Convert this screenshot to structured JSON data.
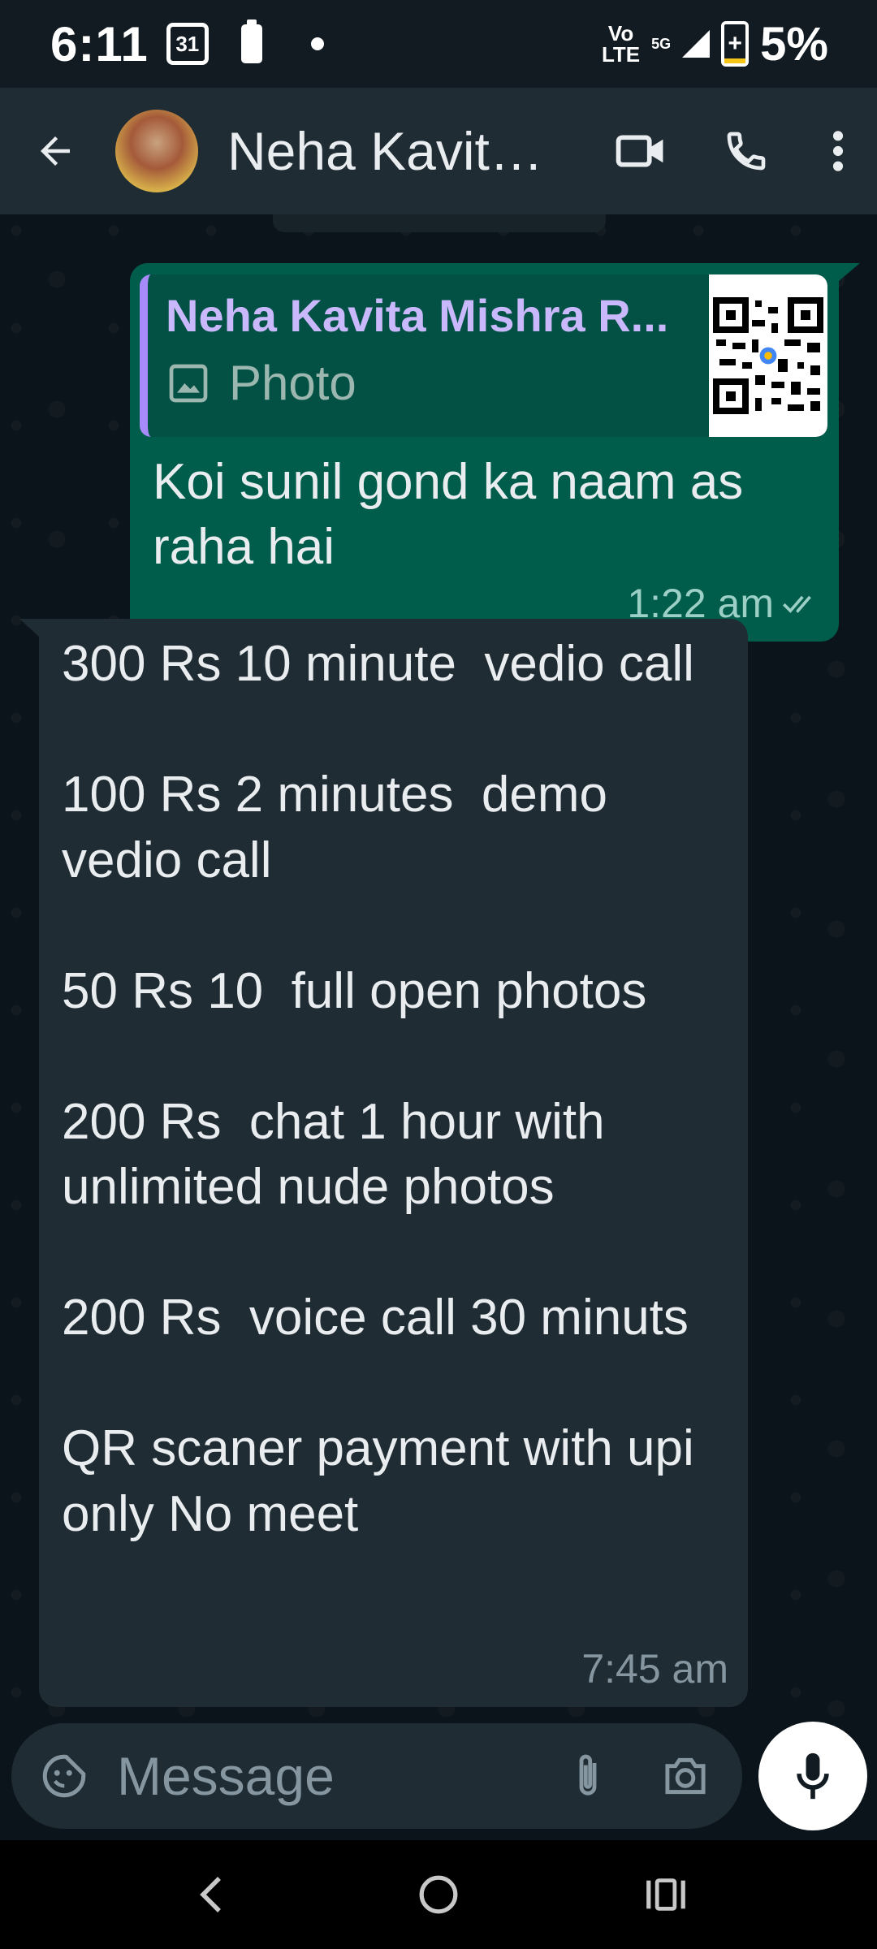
{
  "status_bar": {
    "time": "6:11",
    "calendar_date": "31",
    "network_volte": "Vo\nLTE",
    "network_5g": "5G",
    "battery_percent": "5%"
  },
  "header": {
    "contact_name": "Neha Kavita Mishra R...",
    "contact_name_display": "Neha Kavit..."
  },
  "messages": {
    "outgoing": {
      "quote_author": "Neha Kavita Mishra R...",
      "quote_type": "Photo",
      "text": "Koi sunil gond ka naam as raha hai",
      "time": "1:22 am",
      "status": "read"
    },
    "incoming": {
      "text": "300 Rs 10 minute  vedio call\n\n100 Rs 2 minutes  demo vedio call\n\n50 Rs 10  full open photos\n\n200 Rs  chat 1 hour with unlimited nude photos\n\n200 Rs  voice call 30 minuts\n\nQR scaner payment with upi only No meet",
      "time": "7:45 am"
    }
  },
  "composer": {
    "placeholder": "Message"
  },
  "colors": {
    "outgoing_bubble": "#005c4b",
    "incoming_bubble": "#202c33",
    "app_bar": "#1f2c34",
    "background": "#0b141a"
  }
}
